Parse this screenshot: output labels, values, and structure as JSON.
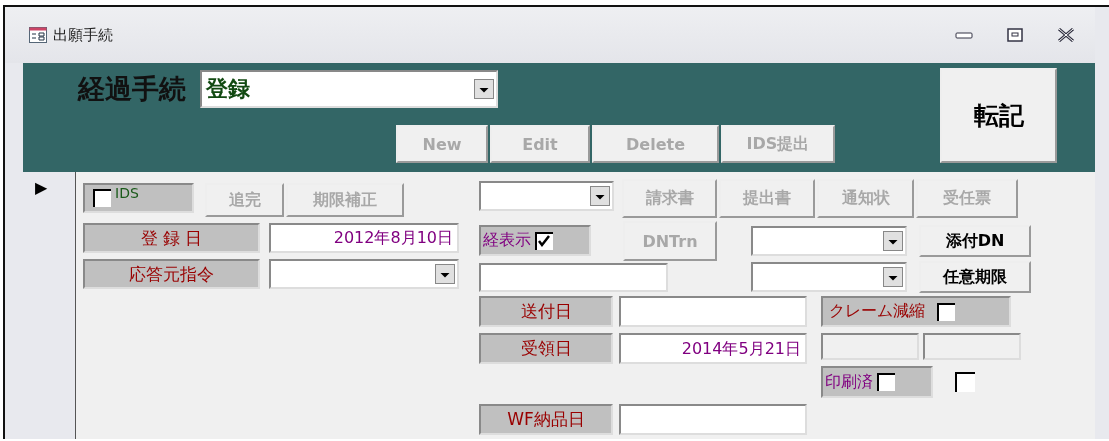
{
  "window": {
    "title": "出願手続"
  },
  "header": {
    "label": "経過手続",
    "procedure": {
      "value": "登録"
    },
    "buttons": [
      {
        "label": "New",
        "disabled": true
      },
      {
        "label": "Edit",
        "disabled": true
      },
      {
        "label": "Delete",
        "disabled": true
      },
      {
        "label": "IDS提出",
        "disabled": true
      }
    ],
    "post_button": {
      "label": "転記",
      "disabled": false
    }
  },
  "record_selector": "▶",
  "detail": {
    "ids": {
      "label": "IDS",
      "checked": false
    },
    "buttons": [
      {
        "label": "追完",
        "disabled": true
      },
      {
        "label": "期限補正",
        "disabled": true
      }
    ],
    "left_fields": [
      {
        "label": "登 録 日",
        "kind": "text",
        "value": "2012年8月10日"
      },
      {
        "label": "応答元指令",
        "kind": "combo"
      }
    ],
    "doc_buttons": [
      {
        "label": "請求書",
        "disabled": true
      },
      {
        "label": "提出書",
        "disabled": true
      },
      {
        "label": "通知状",
        "disabled": true
      },
      {
        "label": "受任票",
        "disabled": true
      }
    ],
    "keihyoji": {
      "label": "経表示",
      "checked": true
    },
    "dntrn": {
      "label": "DNTrn",
      "disabled": true
    },
    "side_buttons": [
      {
        "label": "添付DN",
        "disabled": false
      },
      {
        "label": "任意期限",
        "disabled": false
      }
    ],
    "date_fields": [
      {
        "label": "送付日"
      },
      {
        "label": "受領日",
        "value": "2014年5月21日"
      },
      {
        "label": "WF納品日"
      }
    ],
    "claim": {
      "label": "クレーム減縮",
      "checked": false
    },
    "printed": {
      "label": "印刷済",
      "checked": false
    },
    "extra_checkbox": {
      "checked": false
    }
  }
}
